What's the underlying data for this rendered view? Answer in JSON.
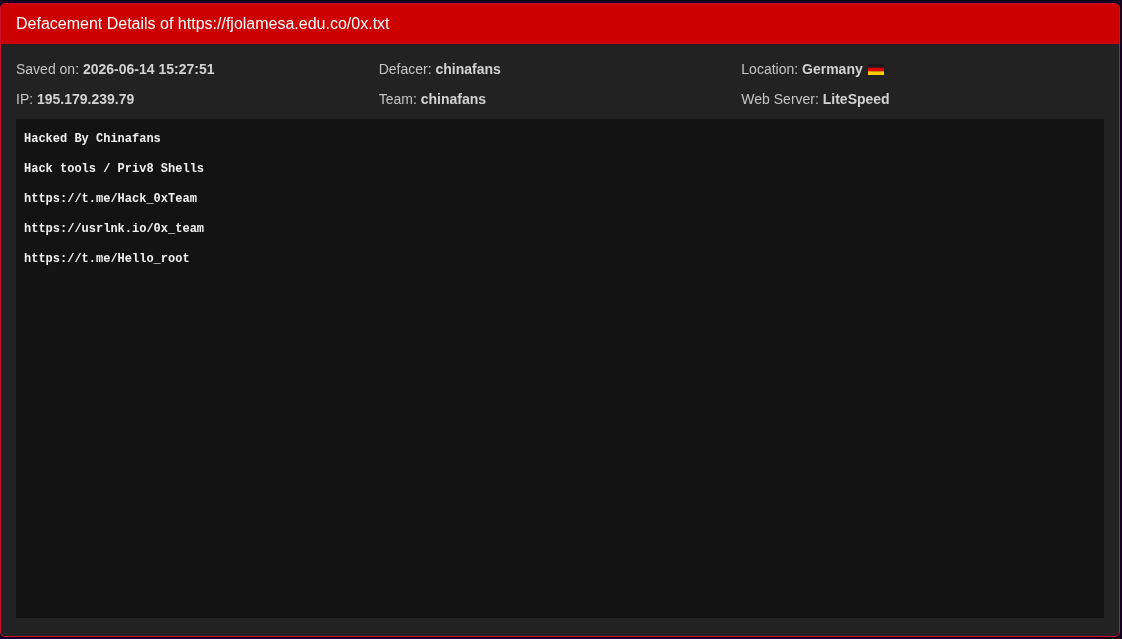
{
  "window": {
    "title": "Defacement Details of https://fjolamesa.edu.co/0x.txt"
  },
  "details": [
    {
      "text": "Saved on: **2026-06-14 15:27:51**",
      "flag": false
    },
    {
      "text": "Defacer: **chinafans**",
      "flag": false
    },
    {
      "text": "Location: **Germany**",
      "flag": true
    },
    {
      "text": "IP: **195.179.239.79**",
      "flag": false
    },
    {
      "text": "Team: **chinafans**",
      "flag": false
    },
    {
      "text": "Web Server: **LiteSpeed**",
      "flag": false
    }
  ],
  "content": {
    "lines": [
      "Hacked By Chinafans",
      "Hack tools / Priv8 Shells",
      "https://t.me/Hack_0xTeam",
      "https://usrlnk.io/0x_team",
      "https://t.me/Hello_root"
    ]
  }
}
